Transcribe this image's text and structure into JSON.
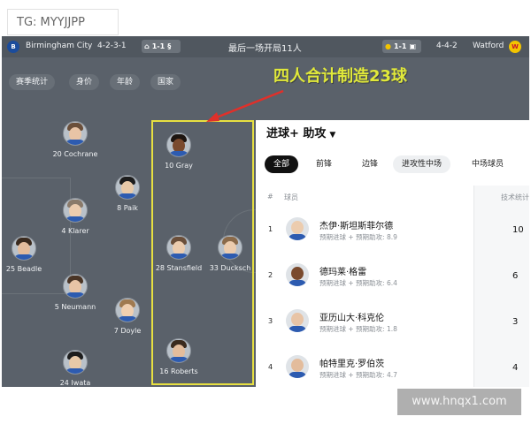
{
  "watermark_top": "TG: MYYJJPP",
  "watermark_bottom": "www.hnqx1.com",
  "match": {
    "home_team": "Birmingham City",
    "home_formation": "4-2-3-1",
    "score": "1-1",
    "title": "最后一场开局11人",
    "away_formation": "4-4-2",
    "away_team": "Watford",
    "home_color": "#1b4c9c",
    "away_color": "#f2c400"
  },
  "filter_chips": [
    "赛季统计",
    "身价",
    "年龄",
    "国家"
  ],
  "annotation": "四人合计制造23球",
  "highlight_color": "#e7e041",
  "lineup": [
    {
      "label": "20 Cochrane"
    },
    {
      "label": "8 Paik"
    },
    {
      "label": "4 Klarer"
    },
    {
      "label": "25 Beadle"
    },
    {
      "label": "5 Neumann"
    },
    {
      "label": "7 Doyle"
    },
    {
      "label": "24 Iwata"
    },
    {
      "label": "10 Gray"
    },
    {
      "label": "28 Stansfield"
    },
    {
      "label": "33 Ducksch"
    },
    {
      "label": "16 Roberts"
    }
  ],
  "panel": {
    "title": "进球+ 助攻",
    "tabs": [
      "全部",
      "前锋",
      "边锋",
      "进攻性中场",
      "中场球员"
    ],
    "active_tab": "全部",
    "col_rank": "#",
    "col_player": "球员",
    "col_stat": "技术统计",
    "rows": [
      {
        "rank": "1",
        "name": "杰伊·斯坦斯菲尔德",
        "sub": "预期进球 + 预期助攻: 8.9",
        "value": "10"
      },
      {
        "rank": "2",
        "name": "德玛莱·格雷",
        "sub": "预期进球 + 预期助攻: 6.4",
        "value": "6"
      },
      {
        "rank": "3",
        "name": "亚历山大·科克伦",
        "sub": "预期进球 + 预期助攻: 1.8",
        "value": "3"
      },
      {
        "rank": "4",
        "name": "帕特里克·罗伯茨",
        "sub": "预期进球 + 预期助攻: 4.7",
        "value": "4"
      }
    ]
  }
}
